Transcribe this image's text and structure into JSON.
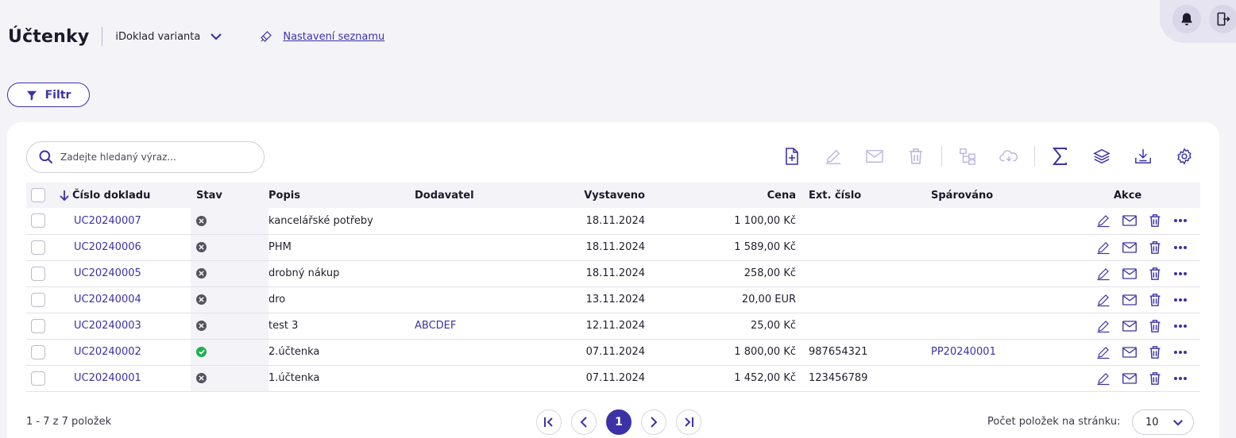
{
  "header": {
    "title": "Účtenky",
    "variant": "iDoklad varianta",
    "settings_link": "Nastavení seznamu"
  },
  "filter": {
    "label": "Filtr"
  },
  "search": {
    "placeholder": "Zadejte hledaný výraz..."
  },
  "toolbar": {
    "icons": [
      "new-document-icon",
      "edit-icon",
      "email-icon",
      "delete-icon",
      "hierarchy-icon",
      "cloud-sync-icon",
      "sum-icon",
      "layers-icon",
      "download-icon",
      "settings-icon"
    ]
  },
  "table": {
    "columns": {
      "number": "Číslo dokladu",
      "status": "Stav",
      "description": "Popis",
      "supplier": "Dodavatel",
      "issued": "Vystaveno",
      "price": "Cena",
      "ext_number": "Ext. číslo",
      "paired": "Spárováno",
      "actions": "Akce"
    },
    "rows": [
      {
        "number": "UC20240007",
        "status": "cancelled",
        "description": "kancelářské potřeby",
        "supplier": "",
        "issued": "18.11.2024",
        "price": "1 100,00 Kč",
        "ext_number": "",
        "paired": ""
      },
      {
        "number": "UC20240006",
        "status": "cancelled",
        "description": "PHM",
        "supplier": "",
        "issued": "18.11.2024",
        "price": "1 589,00 Kč",
        "ext_number": "",
        "paired": ""
      },
      {
        "number": "UC20240005",
        "status": "cancelled",
        "description": "drobný nákup",
        "supplier": "",
        "issued": "18.11.2024",
        "price": "258,00 Kč",
        "ext_number": "",
        "paired": ""
      },
      {
        "number": "UC20240004",
        "status": "cancelled",
        "description": "dro",
        "supplier": "",
        "issued": "13.11.2024",
        "price": "20,00 EUR",
        "ext_number": "",
        "paired": ""
      },
      {
        "number": "UC20240003",
        "status": "cancelled",
        "description": "test 3",
        "supplier": "ABCDEF",
        "issued": "12.11.2024",
        "price": "25,00 Kč",
        "ext_number": "",
        "paired": ""
      },
      {
        "number": "UC20240002",
        "status": "paid",
        "description": "2.účtenka",
        "supplier": "",
        "issued": "07.11.2024",
        "price": "1 800,00 Kč",
        "ext_number": "987654321",
        "paired": "PP20240001"
      },
      {
        "number": "UC20240001",
        "status": "cancelled",
        "description": "1.účtenka",
        "supplier": "",
        "issued": "07.11.2024",
        "price": "1 452,00 Kč",
        "ext_number": "123456789",
        "paired": ""
      }
    ]
  },
  "footer": {
    "count": "1 - 7 z 7 položek",
    "current_page": "1",
    "per_page_label": "Počet položek na stránku:",
    "per_page_value": "10"
  },
  "colors": {
    "accent": "#3b32a8",
    "status_ok": "#1bb24f",
    "status_cancelled": "#545460"
  }
}
